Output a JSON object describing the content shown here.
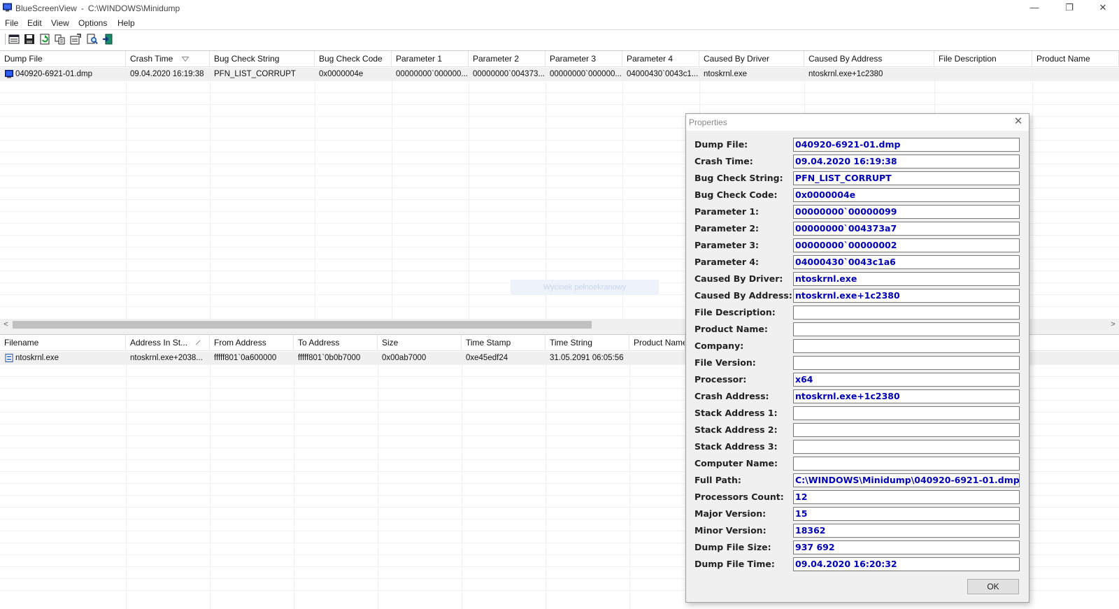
{
  "window": {
    "app_name": "BlueScreenView",
    "separator": "-",
    "path": "C:\\WINDOWS\\Minidump",
    "minimize": "—",
    "restore": "❐",
    "close": "✕"
  },
  "menu": [
    "File",
    "Edit",
    "View",
    "Options",
    "Help"
  ],
  "toolbar_icons": [
    "options-icon",
    "save-icon",
    "refresh-icon",
    "copy-icon",
    "properties-icon",
    "find-icon",
    "exit-icon"
  ],
  "upper_table": {
    "columns": [
      "Dump File",
      "Crash Time",
      "Bug Check String",
      "Bug Check Code",
      "Parameter 1",
      "Parameter 2",
      "Parameter 3",
      "Parameter 4",
      "Caused By Driver",
      "Caused By Address",
      "File Description",
      "Product Name"
    ],
    "sorted_column": "Crash Time",
    "rows": [
      [
        "040920-6921-01.dmp",
        "09.04.2020 16:19:38",
        "PFN_LIST_CORRUPT",
        "0x0000004e",
        "00000000`000000...",
        "00000000`004373...",
        "00000000`000000...",
        "04000430`0043c1...",
        "ntoskrnl.exe",
        "ntoskrnl.exe+1c2380",
        "",
        ""
      ]
    ]
  },
  "lower_table": {
    "columns": [
      "Filename",
      "Address In St...",
      "From Address",
      "To Address",
      "Size",
      "Time Stamp",
      "Time String",
      "Product Name"
    ],
    "sorted_column": "Address In St...",
    "rows": [
      [
        "ntoskrnl.exe",
        "ntoskrnl.exe+2038...",
        "fffff801`0a600000",
        "fffff801`0b0b7000",
        "0x00ab7000",
        "0xe45edf24",
        "31.05.2091 06:05:56",
        ""
      ]
    ]
  },
  "watermark": "Wycinek pełnoekranowy",
  "scrollbar": {
    "left_arrow": "<",
    "right_arrow": ">"
  },
  "dialog": {
    "title": "Properties",
    "close": "✕",
    "ok_label": "OK",
    "properties": [
      {
        "label": "Dump File:",
        "value": "040920-6921-01.dmp"
      },
      {
        "label": "Crash Time:",
        "value": "09.04.2020 16:19:38"
      },
      {
        "label": "Bug Check String:",
        "value": "PFN_LIST_CORRUPT"
      },
      {
        "label": "Bug Check Code:",
        "value": "0x0000004e"
      },
      {
        "label": "Parameter 1:",
        "value": "00000000`00000099"
      },
      {
        "label": "Parameter 2:",
        "value": "00000000`004373a7"
      },
      {
        "label": "Parameter 3:",
        "value": "00000000`00000002"
      },
      {
        "label": "Parameter 4:",
        "value": "04000430`0043c1a6"
      },
      {
        "label": "Caused By Driver:",
        "value": "ntoskrnl.exe"
      },
      {
        "label": "Caused By Address:",
        "value": "ntoskrnl.exe+1c2380"
      },
      {
        "label": "File Description:",
        "value": ""
      },
      {
        "label": "Product Name:",
        "value": ""
      },
      {
        "label": "Company:",
        "value": ""
      },
      {
        "label": "File Version:",
        "value": ""
      },
      {
        "label": "Processor:",
        "value": "x64"
      },
      {
        "label": "Crash Address:",
        "value": "ntoskrnl.exe+1c2380"
      },
      {
        "label": "Stack Address 1:",
        "value": ""
      },
      {
        "label": "Stack Address 2:",
        "value": ""
      },
      {
        "label": "Stack Address 3:",
        "value": ""
      },
      {
        "label": "Computer Name:",
        "value": ""
      },
      {
        "label": "Full Path:",
        "value": "C:\\WINDOWS\\Minidump\\040920-6921-01.dmp"
      },
      {
        "label": "Processors Count:",
        "value": "12"
      },
      {
        "label": "Major Version:",
        "value": "15"
      },
      {
        "label": "Minor Version:",
        "value": "18362"
      },
      {
        "label": "Dump File Size:",
        "value": "937 692"
      },
      {
        "label": "Dump File Time:",
        "value": "09.04.2020 16:20:32"
      }
    ]
  }
}
